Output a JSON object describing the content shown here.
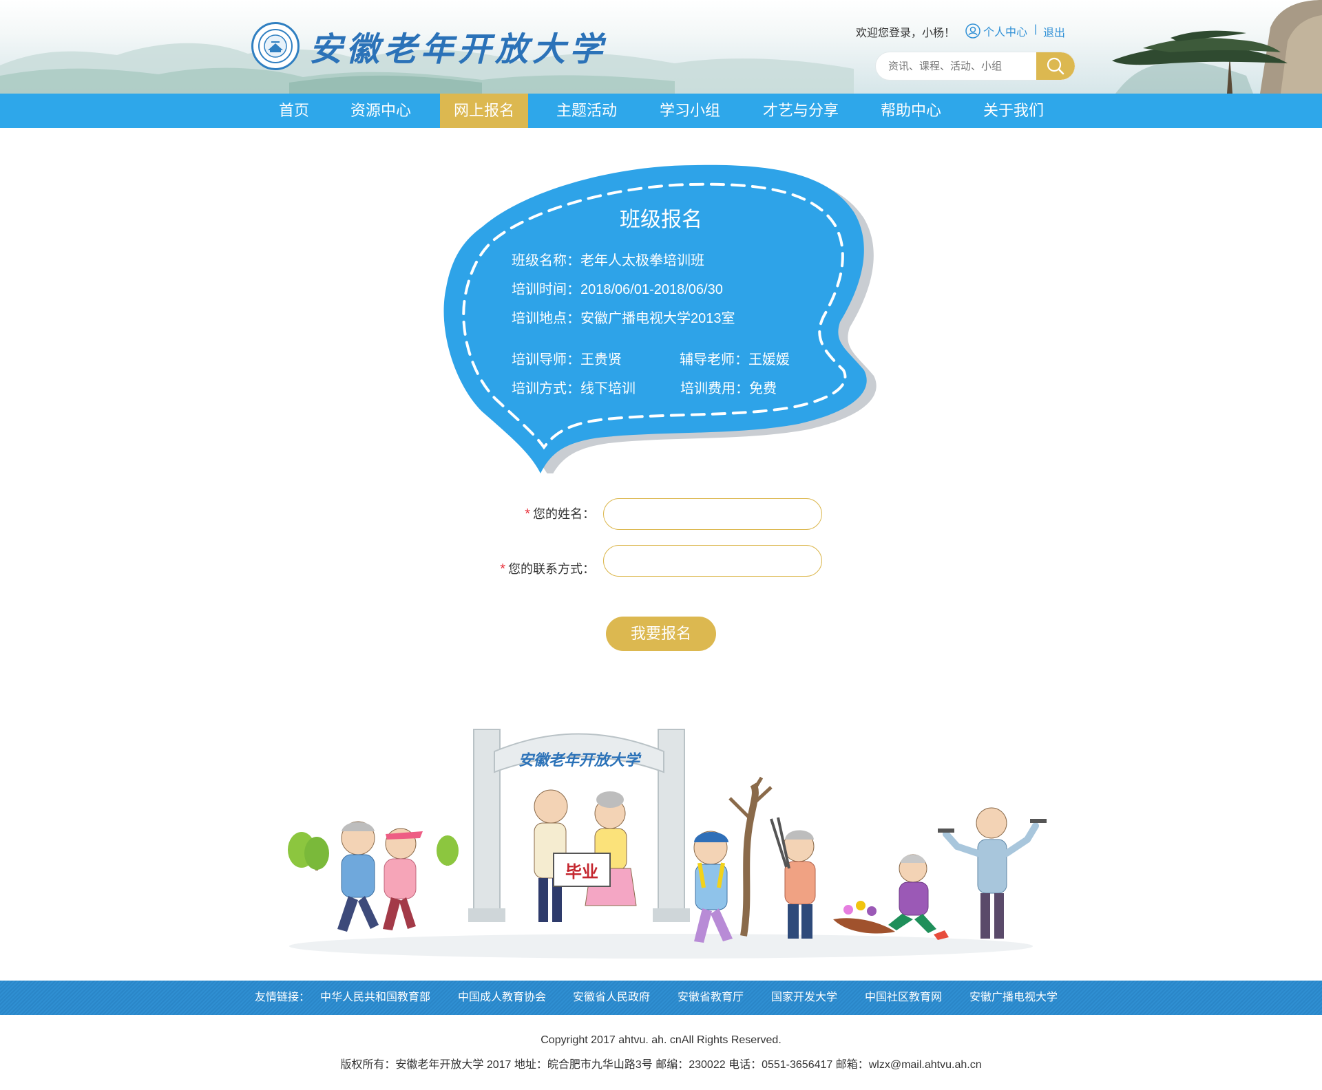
{
  "header": {
    "logo_text": "安徽老年开放大学",
    "welcome": "欢迎您登录，小杨！",
    "user_center": "个人中心",
    "separator": "|",
    "logout": "退出",
    "search_placeholder": "资讯、课程、活动、小组"
  },
  "nav": {
    "items": [
      "首页",
      "资源中心",
      "网上报名",
      "主题活动",
      "学习小组",
      "才艺与分享",
      "帮助中心",
      "关于我们"
    ],
    "active": "网上报名"
  },
  "card": {
    "title": "班级报名",
    "class_name": "班级名称：老年人太极拳培训班",
    "time": "培训时间：2018/06/01-2018/06/30",
    "location": "培训地点：安徽广播电视大学2013室",
    "teacher": "培训导师：王贵贤",
    "assistant": "辅导老师：王媛媛",
    "mode": "培训方式：线下培训",
    "fee": "培训费用：免费"
  },
  "form": {
    "required_mark": "*",
    "name_label": "您的姓名：",
    "contact_label": "您的联系方式：",
    "name_value": "",
    "contact_value": "",
    "submit": "我要报名"
  },
  "illustration": {
    "arch_text": "安徽老年开放大学",
    "sign_text": "毕业"
  },
  "footer": {
    "links_label": "友情链接：",
    "links": [
      "中华人民共和国教育部",
      "中国成人教育协会",
      "安徽省人民政府",
      "安徽省教育厅",
      "国家开发大学",
      "中国社区教育网",
      "安徽广播电视大学"
    ],
    "copyright": "Copyright 2017 ahtvu. ah. cnAll Rights Reserved.",
    "info": "版权所有：安徽老年开放大学 2017 地址：皖合肥市九华山路3号 邮编：230022 电话：0551-3656417 邮箱：wlzx@mail.ahtvu.ah.cn"
  },
  "colors": {
    "nav_blue": "#2ea7ea",
    "gold": "#dcb850",
    "card_blue": "#2ea3e8",
    "footer_blue": "#2a86c8",
    "required_red": "#e8303a"
  }
}
